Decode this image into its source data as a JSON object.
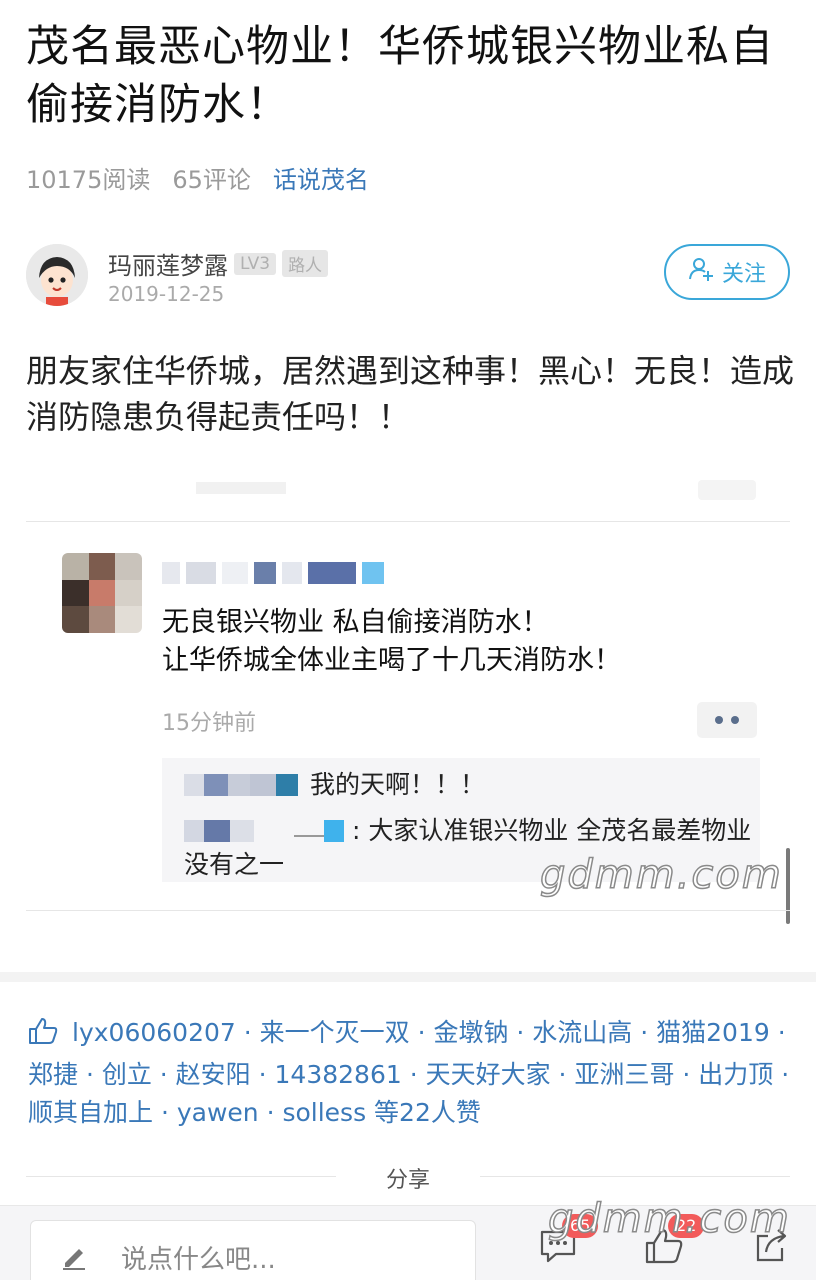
{
  "article": {
    "title": "茂名最恶心物业！华侨城银兴物业私自偷接消防水！",
    "reads": "10175阅读",
    "comments": "65评论",
    "topic": "话说茂名"
  },
  "author": {
    "name": "玛丽莲梦露",
    "level": "LV3",
    "role": "路人",
    "date": "2019-12-25",
    "follow_label": "关注"
  },
  "post_body": "朋友家住华侨城，居然遇到这种事！黑心！无良！造成消防隐患负得起责任吗！！",
  "comment": {
    "text_line1": "无良银兴物业 私自偷接消防水！",
    "text_line2": "让华侨城全体业主喝了十几天消防水！",
    "time": "15分钟前",
    "replies": [
      {
        "text": "我的天啊！！！"
      },
      {
        "text": ": 大家认准银兴物业 全茂名最差物业 没有之一"
      }
    ]
  },
  "likes_text": "lyx06060207 · 来一个灭一双 · 金墩钠 · 水流山高 · 猫猫2019 · 郑捷 · 创立 · 赵安阳 · 14382861 · 天天好大家 · 亚洲三哥 · 出力顶 · 顺其自加上 · yawen · solless 等22人赞",
  "share_label": "分享",
  "watermark": "gdmm.com",
  "bottom_bar": {
    "input_placeholder": "说点什么吧...",
    "comment_count": "65",
    "like_count": "22"
  },
  "colors": {
    "accent": "#3aa7d9",
    "link": "#3a78b8",
    "badge_red": "#f25b5b"
  }
}
